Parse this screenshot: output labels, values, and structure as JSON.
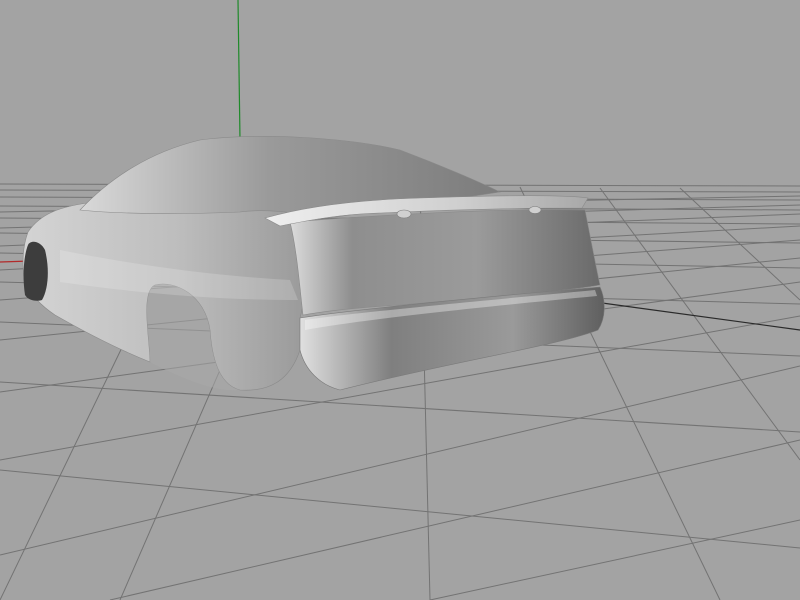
{
  "viewport": {
    "background": "#a3a3a3",
    "grid_line_color": "#6f6f6f",
    "axis_colors": {
      "y_axis": "#1f8a2a",
      "x_axis": "#b22a2a",
      "z_axis": "#2a2a2a"
    }
  },
  "scene": {
    "object": "car-body-shell",
    "shading": "smooth-gray"
  }
}
